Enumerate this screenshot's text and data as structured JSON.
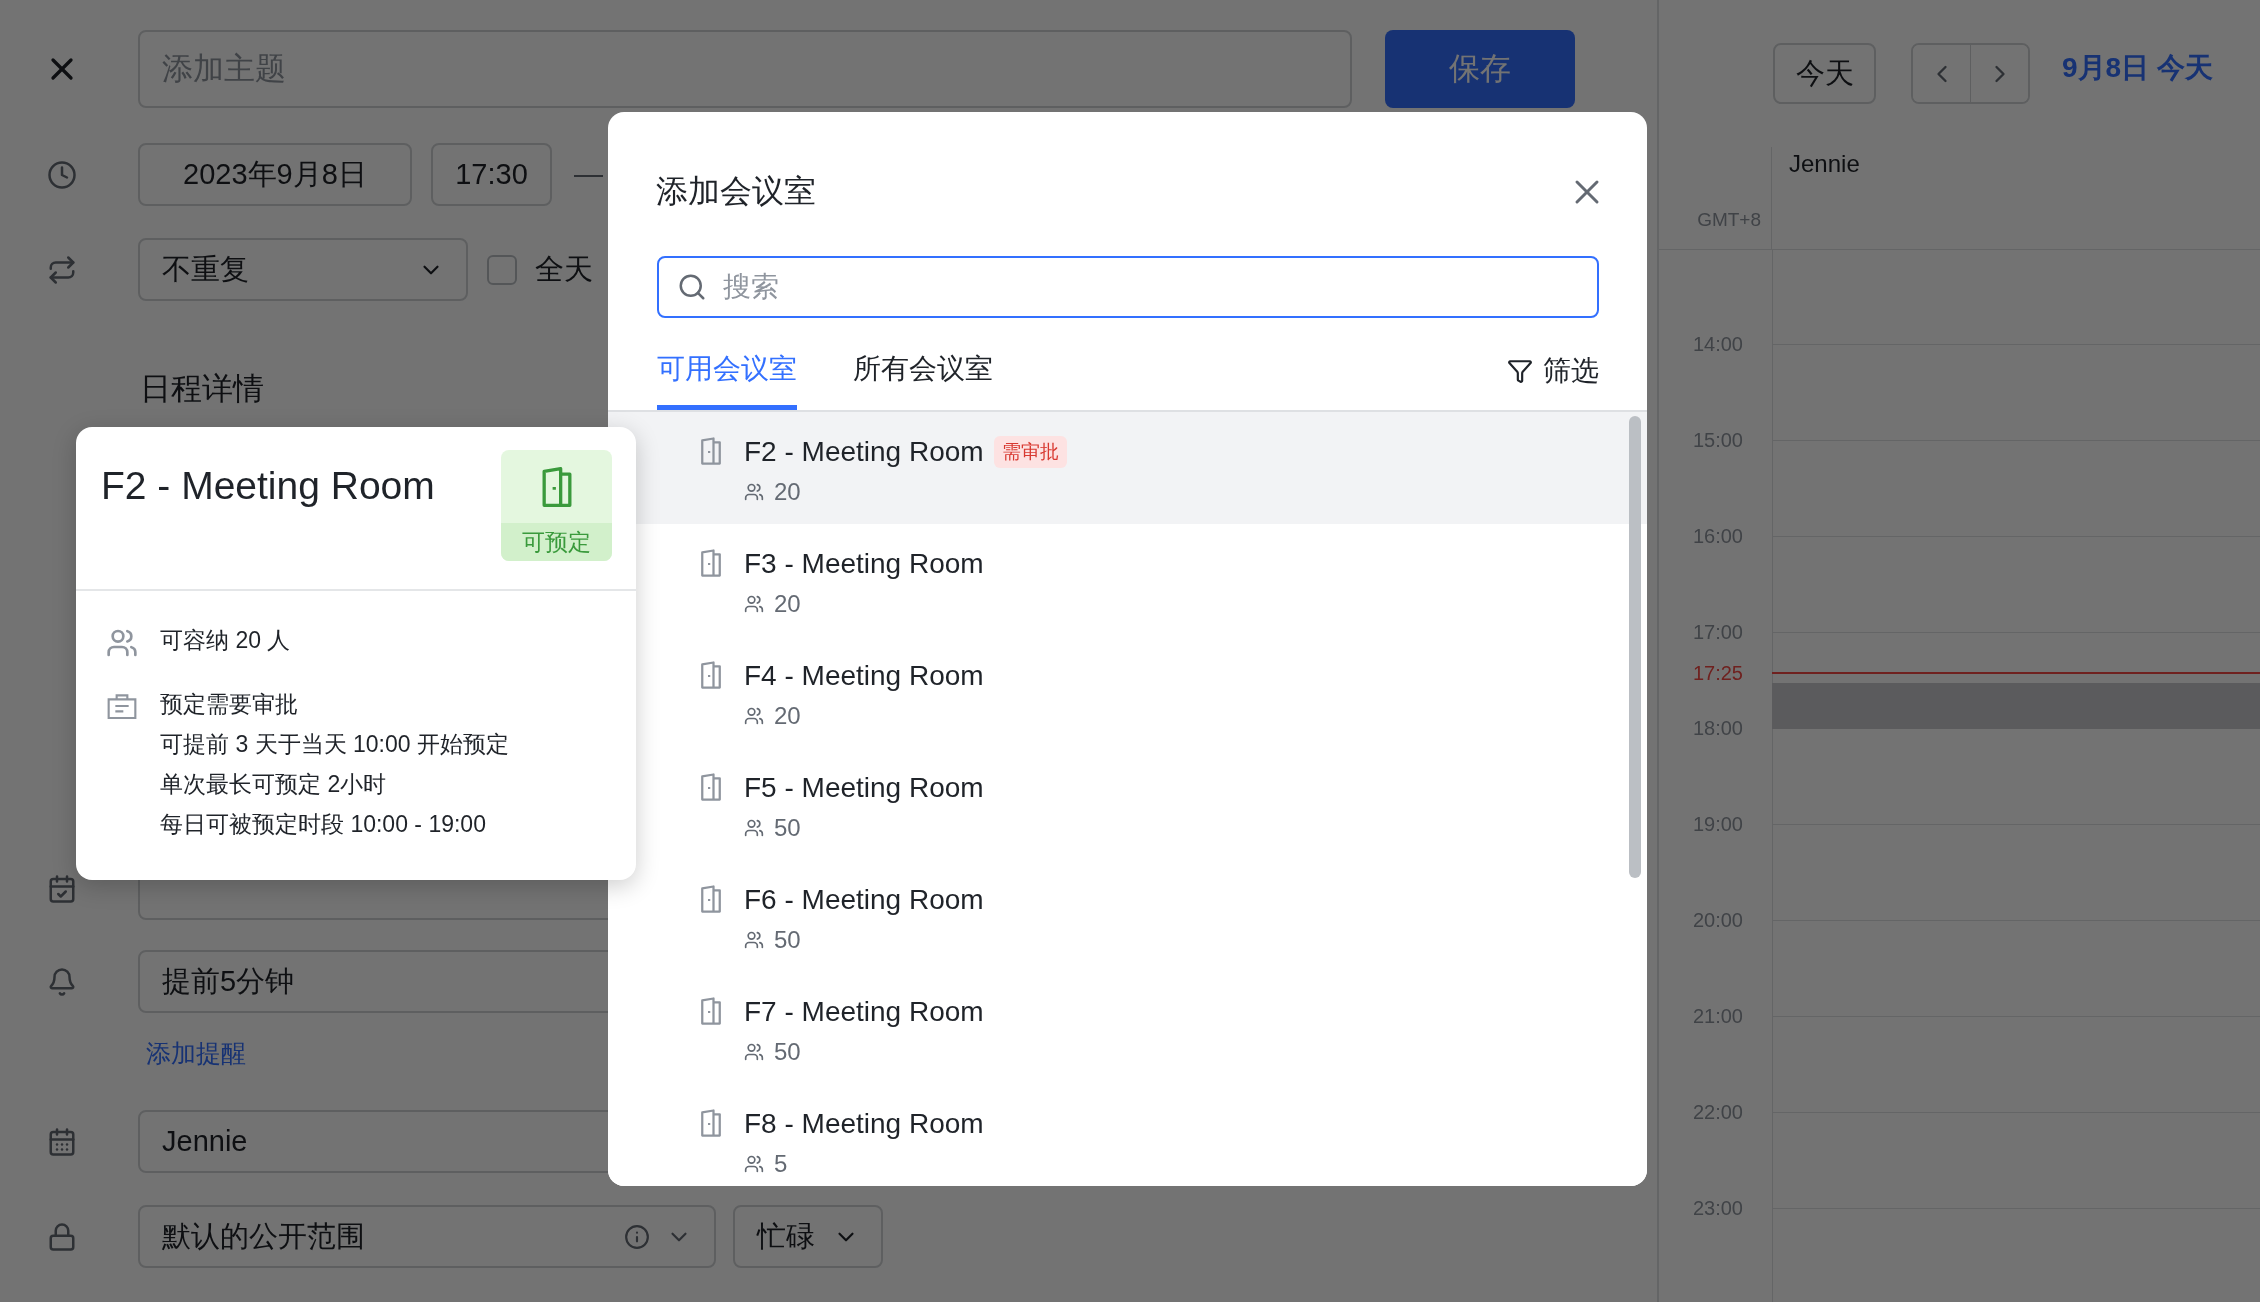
{
  "form": {
    "title_placeholder": "添加主题",
    "save_button": "保存",
    "date": "2023年9月8日",
    "start_time": "17:30",
    "end_separator": "—",
    "repeat": "不重复",
    "all_day": {
      "label": "全天",
      "checked": false
    },
    "section_title": "日程详情",
    "reminder": "提前5分钟",
    "add_reminder": "添加提醒",
    "calendar": "Jennie",
    "visibility": "默认的公开范围",
    "busy_status": "忙碌"
  },
  "calendar": {
    "today_button": "今天",
    "date_title": "9月8日 今天",
    "column_name": "Jennie",
    "timezone": "GMT+8",
    "hours": [
      "14:00",
      "15:00",
      "16:00",
      "17:00",
      "18:00",
      "19:00",
      "20:00",
      "21:00",
      "22:00",
      "23:00"
    ],
    "now": "17:25"
  },
  "modal": {
    "title": "添加会议室",
    "search": {
      "placeholder": "搜索"
    },
    "tabs": [
      {
        "label": "可用会议室",
        "selected": true
      },
      {
        "label": "所有会议室",
        "selected": false
      }
    ],
    "filter": "筛选",
    "rooms": [
      {
        "name": "F2 - Meeting Room",
        "tag": "需审批",
        "capacity": "20",
        "selected": true
      },
      {
        "name": "F3 - Meeting Room",
        "capacity": "20",
        "selected": false
      },
      {
        "name": "F4 - Meeting Room",
        "capacity": "20",
        "selected": false
      },
      {
        "name": "F5 - Meeting Room",
        "capacity": "50",
        "selected": false
      },
      {
        "name": "F6 - Meeting Room",
        "capacity": "50",
        "selected": false
      },
      {
        "name": "F7 - Meeting Room",
        "capacity": "50",
        "selected": false
      },
      {
        "name": "F8 - Meeting Room",
        "capacity": "5",
        "selected": false
      }
    ]
  },
  "room_card": {
    "name": "F2 - Meeting Room",
    "status": "可预定",
    "capacity": "可容纳 20 人",
    "rules": [
      "预定需要审批",
      "可提前 3 天于当天 10:00 开始预定",
      "单次最长可预定 2小时",
      "每日可被预定时段 10:00 - 19:00"
    ]
  }
}
